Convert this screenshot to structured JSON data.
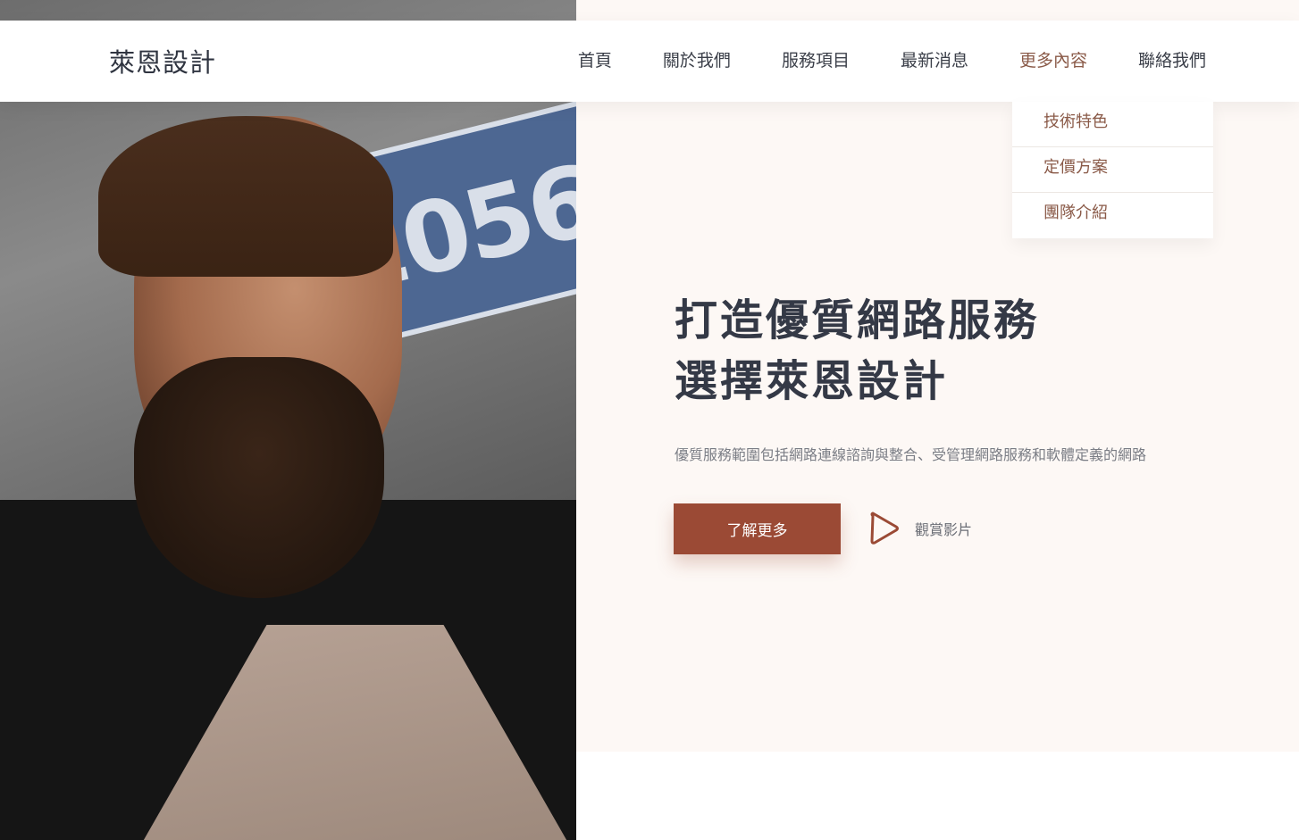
{
  "brand": {
    "logo": "萊恩設計"
  },
  "nav": {
    "items": [
      {
        "label": "首頁"
      },
      {
        "label": "關於我們"
      },
      {
        "label": "服務項目"
      },
      {
        "label": "最新消息"
      },
      {
        "label": "更多內容"
      },
      {
        "label": "聯絡我們"
      }
    ],
    "dropdown": [
      {
        "label": "技術特色"
      },
      {
        "label": "定價方案"
      },
      {
        "label": "團隊介紹"
      }
    ]
  },
  "hero": {
    "headline_line1": "打造優質網路服務",
    "headline_line2": "選擇萊恩設計",
    "subtitle": "優質服務範圍包括網路連線諮詢與整合、受管理網路服務和軟體定義的網路",
    "cta_label": "了解更多",
    "video_label": "觀賞影片",
    "photo_plate_text": "1056"
  },
  "colors": {
    "accent": "#9b4a35",
    "nav_active": "#8a5a48",
    "panel_bg": "#fdf8f5",
    "heading": "#343946"
  },
  "icons": {
    "video": "play-icon"
  }
}
